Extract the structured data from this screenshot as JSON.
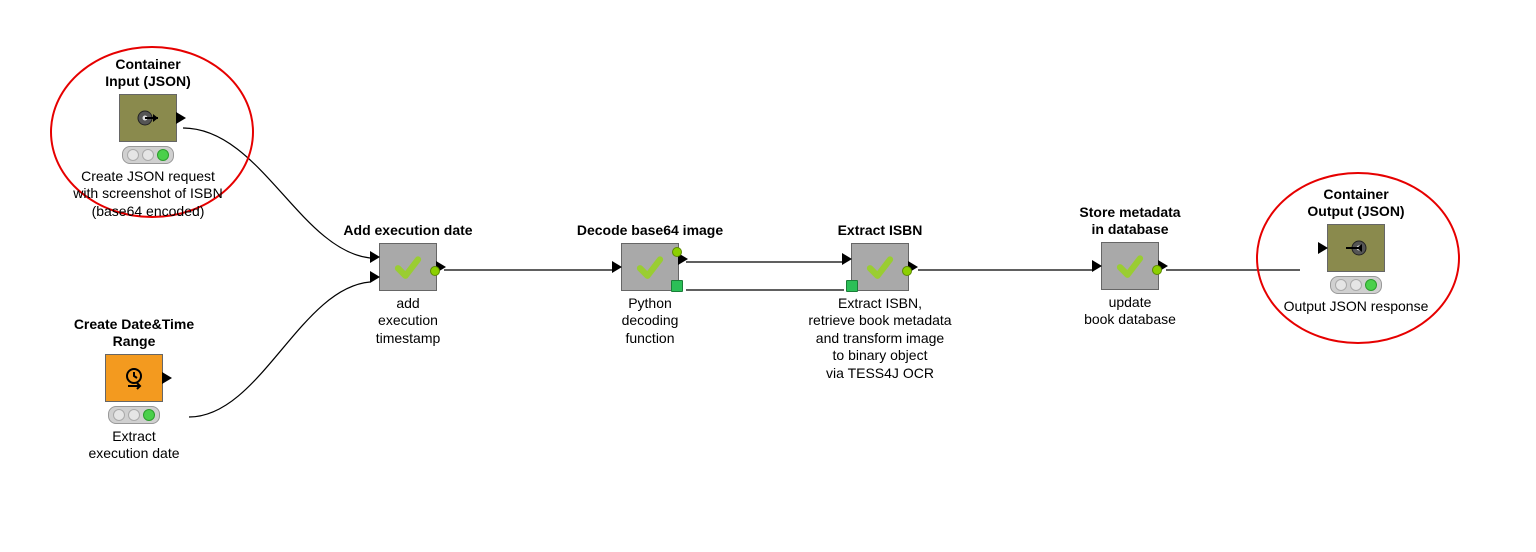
{
  "nodes": {
    "containerInput": {
      "title": "Container\nInput (JSON)",
      "desc": "Create JSON request\nwith screenshot of ISBN\n(base64 encoded)"
    },
    "dateRange": {
      "title": "Create Date&Time\nRange",
      "desc": "Extract\nexecution date"
    },
    "addExec": {
      "title": "Add execution date",
      "desc": "add\nexecution\ntimestamp"
    },
    "decode": {
      "title": "Decode base64 image",
      "desc": "Python\ndecoding\nfunction"
    },
    "extract": {
      "title": "Extract ISBN",
      "desc": "Extract ISBN,\nretrieve book metadata\nand transform image\nto binary object\nvia TESS4J OCR"
    },
    "store": {
      "title": "Store metadata\nin database",
      "desc": "update\nbook database"
    },
    "containerOutput": {
      "title": "Container\nOutput (JSON)",
      "desc": "Output JSON response"
    }
  }
}
